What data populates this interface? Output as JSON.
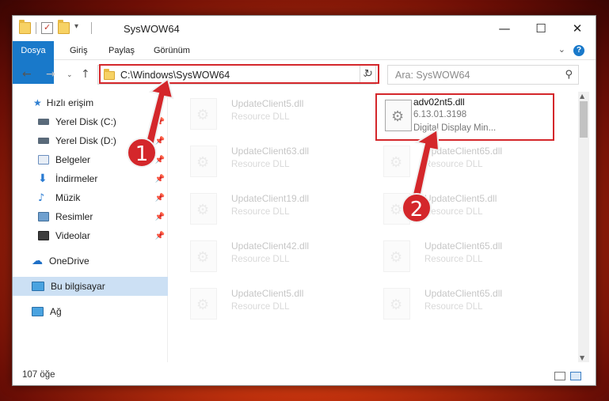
{
  "window": {
    "title": "SysWOW64",
    "minimize": "—",
    "maximize": "☐",
    "close": "✕"
  },
  "ribbon": {
    "tabs": [
      {
        "label": "Dosya"
      },
      {
        "label": "Giriş"
      },
      {
        "label": "Paylaş"
      },
      {
        "label": "Görünüm"
      }
    ],
    "help": "?"
  },
  "address": {
    "path": "C:\\Windows\\SysWOW64",
    "search_placeholder": "Ara: SysWOW64"
  },
  "nav": {
    "items": [
      {
        "label": "Hızlı erişim",
        "icon": "star-icon"
      },
      {
        "label": "Yerel Disk (C:)",
        "icon": "drive-icon",
        "pinned": true
      },
      {
        "label": "Yerel Disk (D:)",
        "icon": "drive-icon",
        "pinned": true
      },
      {
        "label": "Belgeler",
        "icon": "documents-icon",
        "pinned": true
      },
      {
        "label": "İndirmeler",
        "icon": "download-icon",
        "pinned": true
      },
      {
        "label": "Müzik",
        "icon": "music-icon",
        "pinned": true
      },
      {
        "label": "Resimler",
        "icon": "pictures-icon",
        "pinned": true
      },
      {
        "label": "Videolar",
        "icon": "videos-icon",
        "pinned": true
      },
      {
        "label": "OneDrive",
        "icon": "cloud-icon"
      },
      {
        "label": "Bu bilgisayar",
        "icon": "computer-icon",
        "selected": true
      },
      {
        "label": "Ağ",
        "icon": "network-icon"
      }
    ]
  },
  "files": [
    {
      "name": "UpdateClient5.dll",
      "line2": "Resource DLL"
    },
    {
      "name": "adv02nt5.dll",
      "line2": "6.13.01.3198",
      "line3": "Digital Display Min..."
    },
    {
      "name": "UpdateClient63.dll",
      "line2": "Resource DLL"
    },
    {
      "name": "UpdateClient65.dll",
      "line2": "Resource DLL"
    },
    {
      "name": "UpdateClient19.dll",
      "line2": "Resource DLL"
    },
    {
      "name": "UpdateClient5.dll",
      "line2": "Resource DLL"
    },
    {
      "name": "UpdateClient42.dll",
      "line2": "Resource DLL"
    },
    {
      "name": "UpdateClient65.dll",
      "line2": "Resource DLL"
    },
    {
      "name": "UpdateClient5.dll",
      "line2": "Resource DLL"
    },
    {
      "name": "UpdateClient65.dll",
      "line2": "Resource DLL"
    }
  ],
  "status": {
    "count": "107 öğe"
  },
  "annotations": {
    "step1": "1",
    "step2": "2",
    "color": "#d4272b"
  }
}
